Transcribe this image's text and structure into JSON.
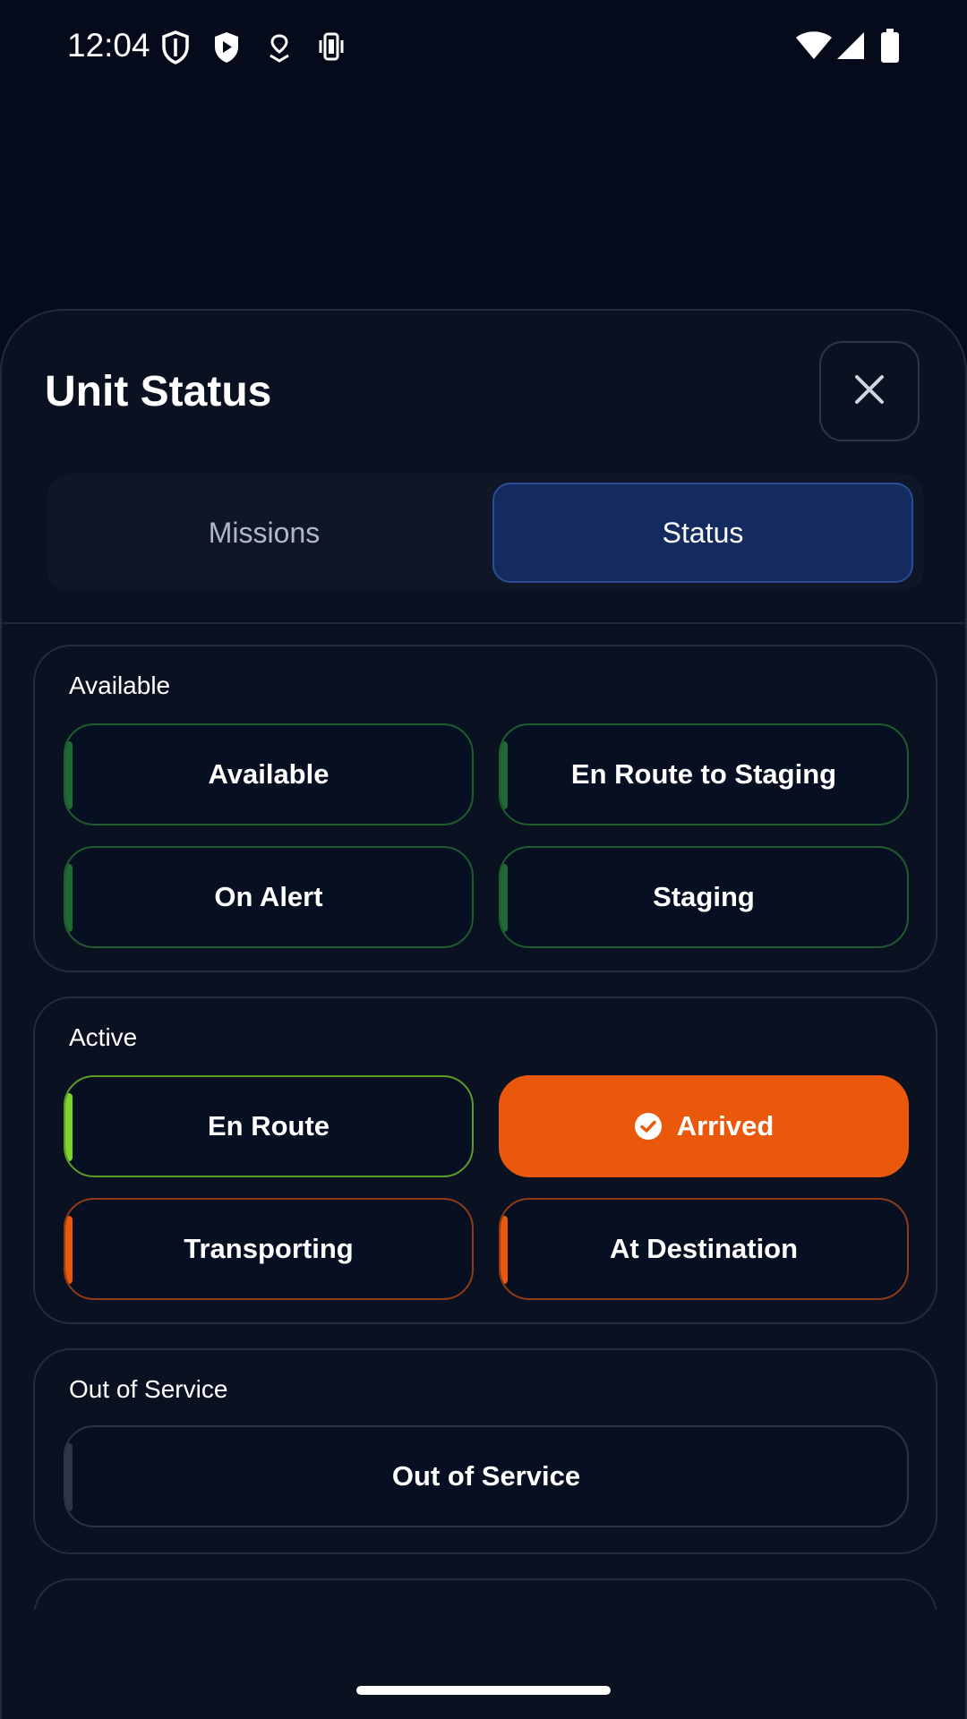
{
  "status_bar": {
    "time": "12:04",
    "left_icons": [
      "shield-outline-icon",
      "play-shield-icon",
      "location-heart-icon",
      "vibrate-icon"
    ],
    "right_icons": [
      "wifi-icon",
      "cell-signal-icon",
      "battery-icon"
    ]
  },
  "sheet": {
    "title": "Unit Status",
    "close_icon": "close-icon",
    "tabs": [
      {
        "label": "Missions",
        "selected": false
      },
      {
        "label": "Status",
        "selected": true
      }
    ]
  },
  "groups": [
    {
      "label": "Available",
      "buttons": [
        {
          "label": "Available"
        },
        {
          "label": "En Route to Staging"
        },
        {
          "label": "On Alert"
        },
        {
          "label": "Staging"
        }
      ]
    },
    {
      "label": "Active",
      "buttons": [
        {
          "label": "En Route"
        },
        {
          "label": "Arrived",
          "selected": true,
          "icon": "check-circle-icon"
        },
        {
          "label": "Transporting"
        },
        {
          "label": "At Destination"
        }
      ]
    },
    {
      "label": "Out of Service",
      "buttons": [
        {
          "label": "Out of Service"
        }
      ]
    }
  ],
  "colors": {
    "background": "#050b1a",
    "sheet": "#0a1120",
    "available_green": "#1f6a32",
    "en_route_lime": "#7fd42a",
    "active_orange": "#ea580c",
    "selected_tab": "#132b5e"
  }
}
